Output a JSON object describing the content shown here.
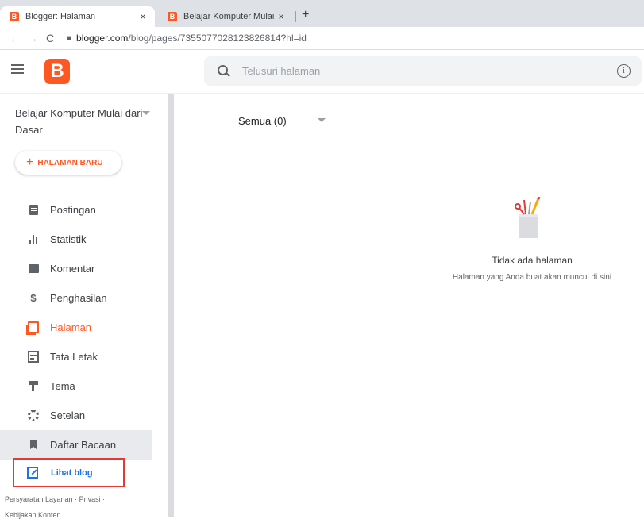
{
  "browser": {
    "tabs": [
      {
        "title": "Blogger: Halaman",
        "active": true
      },
      {
        "title": "Belajar Komputer Mulai dari Dasa",
        "active": false
      }
    ],
    "close_glyph": "×",
    "new_tab_glyph": "+",
    "url_host": "blogger.com",
    "url_path": "/blog/pages/7355077028123826814?hl=id"
  },
  "header": {
    "logo_letter": "B",
    "search_placeholder": "Telusuri halaman",
    "info_glyph": "i"
  },
  "sidebar": {
    "blog_name": "Belajar Komputer Mulai dari Dasar",
    "new_page_label": "HALAMAN BARU",
    "items": [
      {
        "label": "Postingan",
        "icon": "document-icon"
      },
      {
        "label": "Statistik",
        "icon": "bar-chart-icon"
      },
      {
        "label": "Komentar",
        "icon": "comment-icon"
      },
      {
        "label": "Penghasilan",
        "icon": "dollar-icon"
      },
      {
        "label": "Halaman",
        "icon": "pages-icon",
        "active": true
      },
      {
        "label": "Tata Letak",
        "icon": "layout-icon"
      },
      {
        "label": "Tema",
        "icon": "paint-roller-icon"
      },
      {
        "label": "Setelan",
        "icon": "gear-icon"
      },
      {
        "label": "Daftar Bacaan",
        "icon": "bookmark-icon",
        "highlighted": true
      }
    ],
    "view_blog_label": "Lihat blog",
    "footer": {
      "terms": "Persyaratan Layanan",
      "privacy": "Privasi",
      "content_policy": "Kebijakan Konten",
      "separator": "·"
    }
  },
  "main": {
    "filter_label": "Semua (0)",
    "empty_title": "Tidak ada halaman",
    "empty_subtitle": "Halaman yang Anda buat akan muncul di sini"
  },
  "colors": {
    "accent": "#ff5722",
    "link": "#1a73e8",
    "highlight_box": "#e53935"
  }
}
